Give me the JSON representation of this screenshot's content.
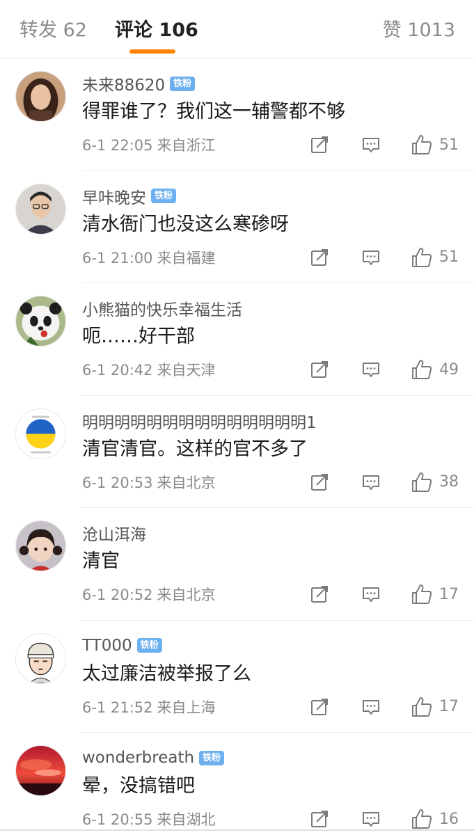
{
  "tabs": [
    {
      "label": "转发",
      "count": "62"
    },
    {
      "label": "评论",
      "count": "106"
    },
    {
      "label": "赞",
      "count": "1013"
    }
  ],
  "accent_color": "#ff8200",
  "badge_color": "#6cb0ef",
  "comments": [
    {
      "user": "未来88620",
      "badge": "铁粉",
      "text": "得罪谁了？我们这一辅警都不够",
      "time": "6-1 22:05",
      "location": "来自浙江",
      "likes": "51"
    },
    {
      "user": "早咔晚安",
      "badge": "铁粉",
      "text": "清水衙门也没这么寒碜呀",
      "time": "6-1 21:00",
      "location": "来自福建",
      "likes": "51"
    },
    {
      "user": "小熊猫的快乐幸福生活",
      "badge": "",
      "text": "呃……好干部",
      "time": "6-1 20:42",
      "location": "来自天津",
      "likes": "49"
    },
    {
      "user": "明明明明明明明明明明明明明明1",
      "badge": "",
      "text": "清官清官。这样的官不多了",
      "time": "6-1 20:53",
      "location": "来自北京",
      "likes": "38"
    },
    {
      "user": "沧山洱海",
      "badge": "",
      "text": "清官",
      "time": "6-1 20:52",
      "location": "来自北京",
      "likes": "17"
    },
    {
      "user": "TT000",
      "badge": "铁粉",
      "text": "太过廉洁被举报了么",
      "time": "6-1 21:52",
      "location": "来自上海",
      "likes": "17"
    },
    {
      "user": "wonderbreath",
      "badge": "铁粉",
      "text": "晕，没搞错吧",
      "time": "6-1 20:55",
      "location": "来自湖北",
      "likes": "16"
    }
  ]
}
